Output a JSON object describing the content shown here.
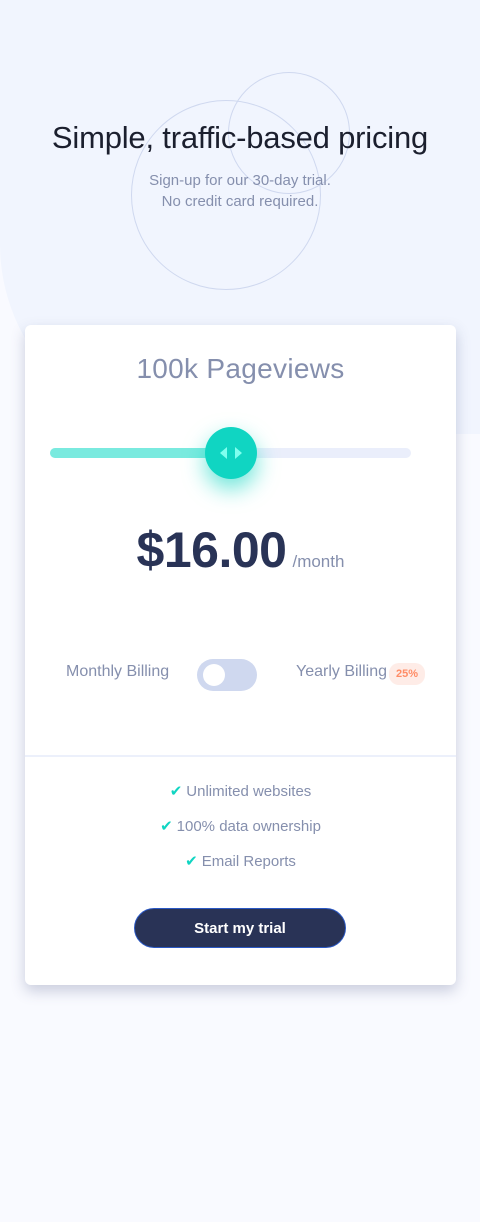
{
  "header": {
    "title": "Simple, traffic-based pricing",
    "subtitle_line1": "Sign-up for our 30-day trial.",
    "subtitle_line2": "No credit card required."
  },
  "pricing": {
    "pageviews_label": "100k Pageviews",
    "slider_fraction": 0.5,
    "price": "$16.00",
    "period": "/month"
  },
  "billing": {
    "monthly_label": "Monthly Billing",
    "yearly_label": "Yearly Billing",
    "discount": "25%",
    "yearly_selected": false
  },
  "features": [
    "Unlimited websites",
    "100% data ownership",
    "Email Reports"
  ],
  "cta": {
    "label": "Start my trial"
  },
  "colors": {
    "accent": "#10d5c2",
    "slider_fill": "#7aeadf",
    "slider_track": "#eaeefb",
    "dark": "#293356",
    "muted": "#858fad",
    "discount_text": "#ff8c66",
    "discount_bg": "#feece7"
  },
  "icons": {
    "thumb": "slider-arrows-icon",
    "feature_check": "check-icon"
  }
}
